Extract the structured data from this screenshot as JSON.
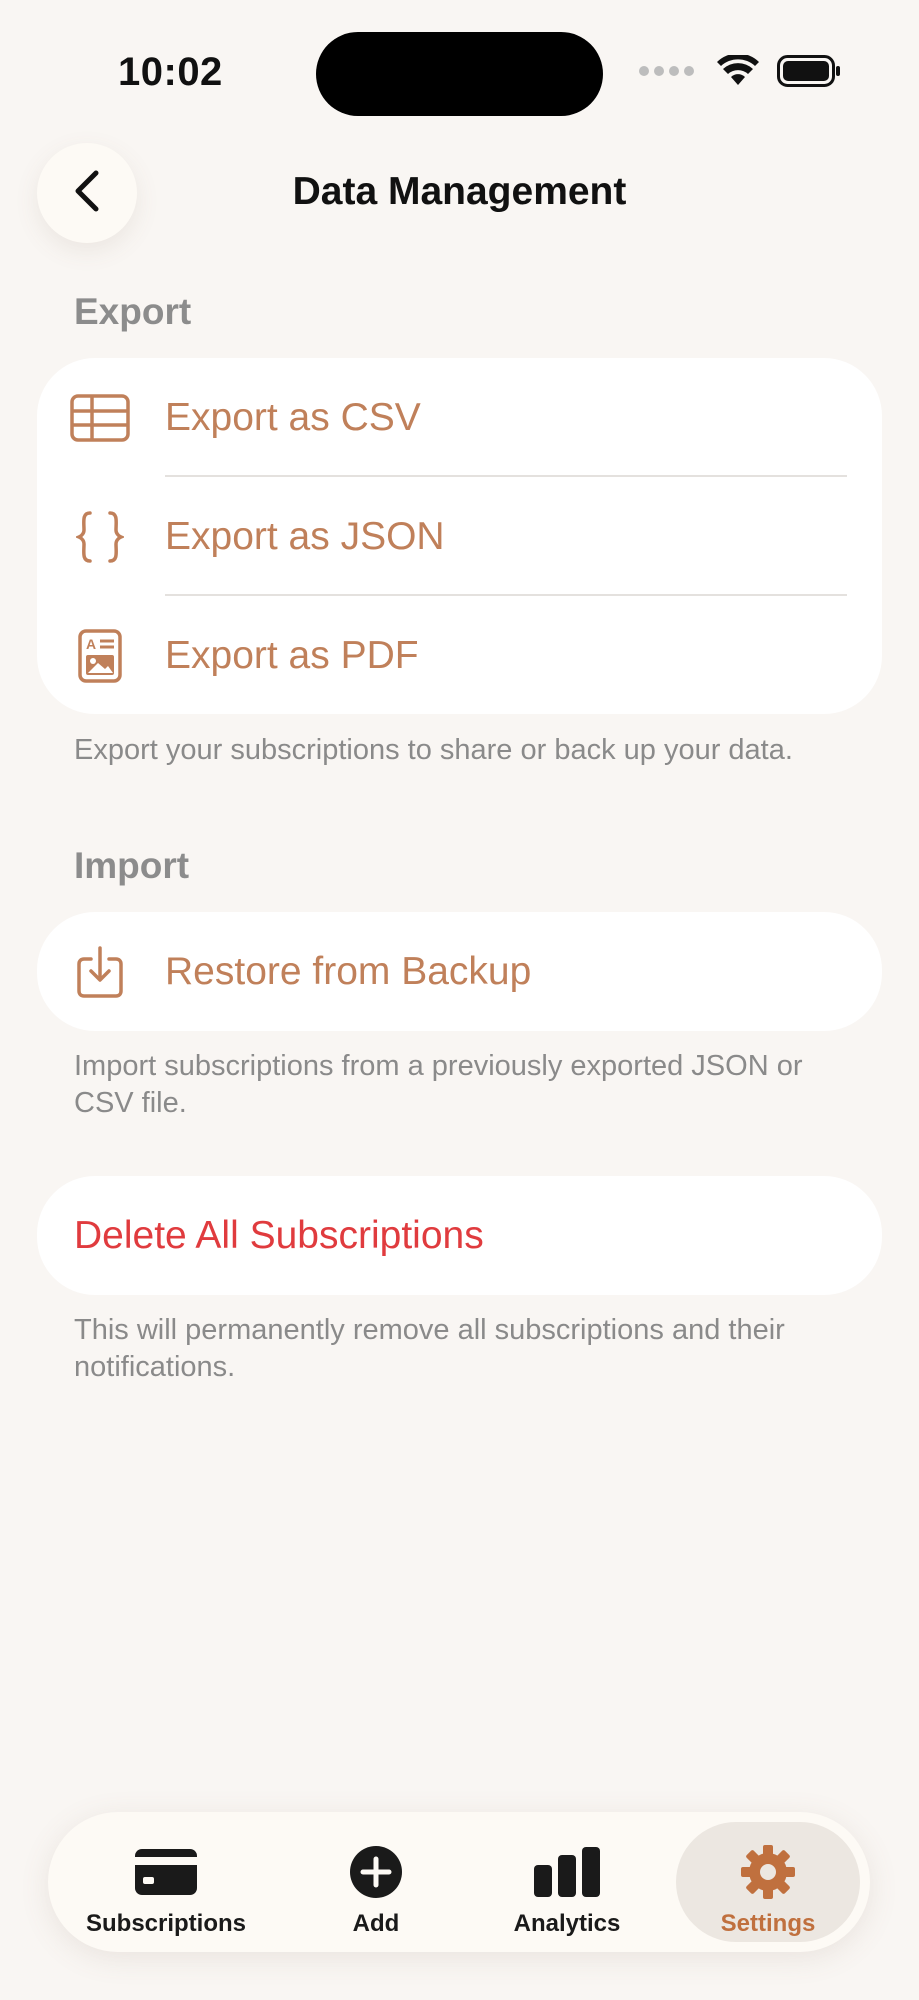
{
  "status_bar": {
    "time": "10:02"
  },
  "nav": {
    "title": "Data Management"
  },
  "export": {
    "header": "Export",
    "items": [
      {
        "label": "Export as CSV",
        "icon": "table-icon"
      },
      {
        "label": "Export as JSON",
        "icon": "braces-icon"
      },
      {
        "label": "Export as PDF",
        "icon": "document-icon"
      }
    ],
    "footnote": "Export your subscriptions to share or back up your data."
  },
  "import": {
    "header": "Import",
    "items": [
      {
        "label": "Restore from Backup",
        "icon": "import-tray-icon"
      }
    ],
    "footnote": "Import subscriptions from a previously exported JSON or CSV file."
  },
  "danger": {
    "label": "Delete All Subscriptions",
    "footnote": "This will permanently remove all subscriptions and their notifications."
  },
  "tabbar": {
    "tabs": [
      {
        "label": "Subscriptions",
        "icon": "credit-card-icon",
        "active": false
      },
      {
        "label": "Add",
        "icon": "plus-circle-icon",
        "active": false
      },
      {
        "label": "Analytics",
        "icon": "bar-chart-icon",
        "active": false
      },
      {
        "label": "Settings",
        "icon": "gear-icon",
        "active": true
      }
    ]
  },
  "colors": {
    "accent": "#c0805a",
    "destructive": "#e03b3e",
    "background": "#f9f6f3"
  }
}
